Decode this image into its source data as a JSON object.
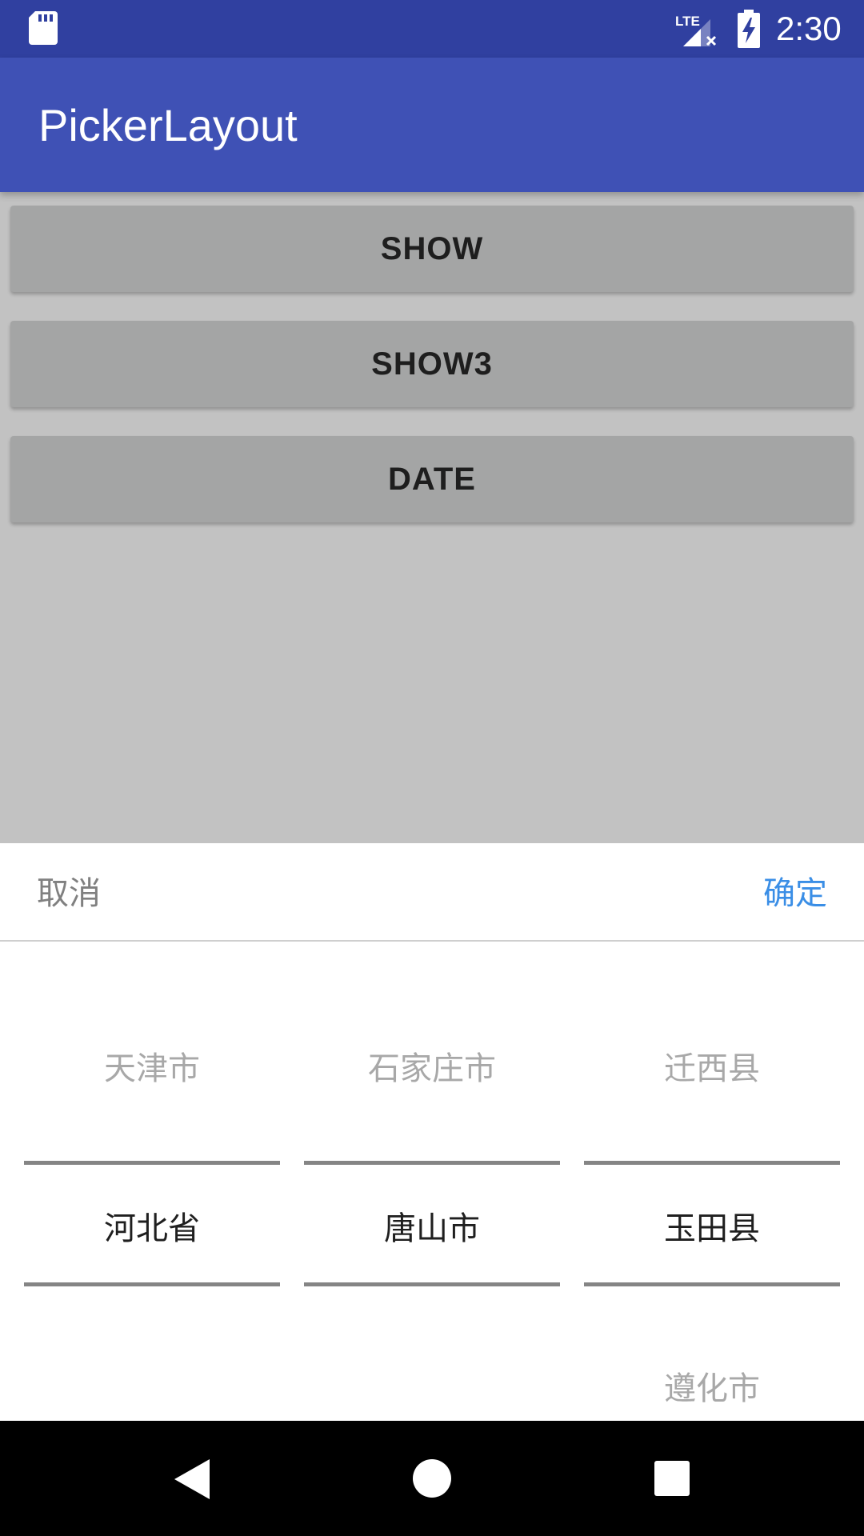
{
  "status_bar": {
    "time": "2:30",
    "icons": [
      "sd-card-icon",
      "lte-signal-icon",
      "battery-charging-icon"
    ],
    "network_label": "LTE"
  },
  "app_bar": {
    "title": "PickerLayout",
    "color": "#3f51b5"
  },
  "buttons": {
    "show": "SHOW",
    "show3": "SHOW3",
    "date": "DATE"
  },
  "picker": {
    "cancel_label": "取消",
    "confirm_label": "确定",
    "confirm_color": "#3a8ee6",
    "columns": [
      {
        "above": "天津市",
        "selected": "河北省",
        "below": ""
      },
      {
        "above": "石家庄市",
        "selected": "唐山市",
        "below": ""
      },
      {
        "above": "迁西县",
        "selected": "玉田县",
        "below": "遵化市"
      }
    ]
  },
  "nav_bar": {
    "icons": [
      "back-icon",
      "home-icon",
      "recents-icon"
    ]
  }
}
